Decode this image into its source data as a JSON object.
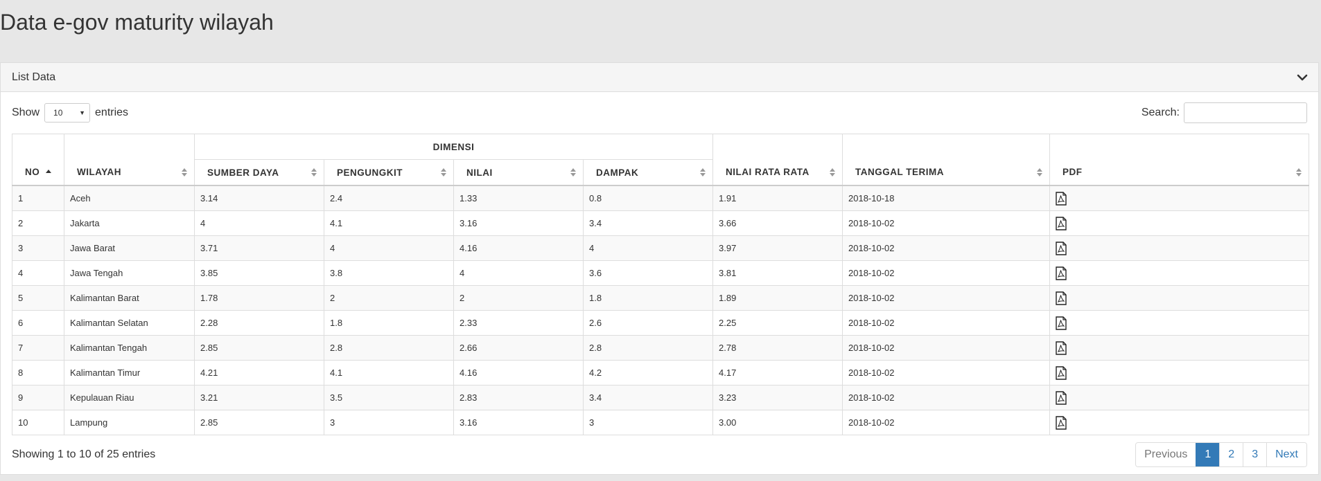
{
  "page": {
    "title": "Data e-gov maturity wilayah"
  },
  "panel": {
    "title": "List Data"
  },
  "controls": {
    "show_label": "Show",
    "entries_label": "entries",
    "page_size": "10",
    "search_label": "Search:",
    "search_value": ""
  },
  "table": {
    "group_header": "DIMENSI",
    "columns": {
      "no": "NO",
      "wilayah": "WILAYAH",
      "sumber_daya": "SUMBER DAYA",
      "pengungkit": "PENGUNGKIT",
      "nilai": "NILAI",
      "dampak": "DAMPAK",
      "nilai_rata_rata": "NILAI RATA RATA",
      "tanggal_terima": "TANGGAL TERIMA",
      "pdf": "PDF"
    },
    "rows": [
      {
        "no": "1",
        "wilayah": "Aceh",
        "sumber_daya": "3.14",
        "pengungkit": "2.4",
        "nilai": "1.33",
        "dampak": "0.8",
        "rata": "1.91",
        "tanggal": "2018-10-18"
      },
      {
        "no": "2",
        "wilayah": "Jakarta",
        "sumber_daya": "4",
        "pengungkit": "4.1",
        "nilai": "3.16",
        "dampak": "3.4",
        "rata": "3.66",
        "tanggal": "2018-10-02"
      },
      {
        "no": "3",
        "wilayah": "Jawa Barat",
        "sumber_daya": "3.71",
        "pengungkit": "4",
        "nilai": "4.16",
        "dampak": "4",
        "rata": "3.97",
        "tanggal": "2018-10-02"
      },
      {
        "no": "4",
        "wilayah": "Jawa Tengah",
        "sumber_daya": "3.85",
        "pengungkit": "3.8",
        "nilai": "4",
        "dampak": "3.6",
        "rata": "3.81",
        "tanggal": "2018-10-02"
      },
      {
        "no": "5",
        "wilayah": "Kalimantan Barat",
        "sumber_daya": "1.78",
        "pengungkit": "2",
        "nilai": "2",
        "dampak": "1.8",
        "rata": "1.89",
        "tanggal": "2018-10-02"
      },
      {
        "no": "6",
        "wilayah": "Kalimantan Selatan",
        "sumber_daya": "2.28",
        "pengungkit": "1.8",
        "nilai": "2.33",
        "dampak": "2.6",
        "rata": "2.25",
        "tanggal": "2018-10-02"
      },
      {
        "no": "7",
        "wilayah": "Kalimantan Tengah",
        "sumber_daya": "2.85",
        "pengungkit": "2.8",
        "nilai": "2.66",
        "dampak": "2.8",
        "rata": "2.78",
        "tanggal": "2018-10-02"
      },
      {
        "no": "8",
        "wilayah": "Kalimantan Timur",
        "sumber_daya": "4.21",
        "pengungkit": "4.1",
        "nilai": "4.16",
        "dampak": "4.2",
        "rata": "4.17",
        "tanggal": "2018-10-02"
      },
      {
        "no": "9",
        "wilayah": "Kepulauan Riau",
        "sumber_daya": "3.21",
        "pengungkit": "3.5",
        "nilai": "2.83",
        "dampak": "3.4",
        "rata": "3.23",
        "tanggal": "2018-10-02"
      },
      {
        "no": "10",
        "wilayah": "Lampung",
        "sumber_daya": "2.85",
        "pengungkit": "3",
        "nilai": "3.16",
        "dampak": "3",
        "rata": "3.00",
        "tanggal": "2018-10-02"
      }
    ]
  },
  "footer": {
    "info": "Showing 1 to 10 of 25 entries",
    "pagination": {
      "previous": "Previous",
      "pages": [
        "1",
        "2",
        "3"
      ],
      "active": "1",
      "next": "Next"
    }
  },
  "icons": {
    "pdf": "pdf-file-icon",
    "collapse": "chevron-down-icon",
    "sort": "sort-icon"
  },
  "colors": {
    "accent": "#337ab7",
    "page_bg": "#e7e7e7"
  }
}
